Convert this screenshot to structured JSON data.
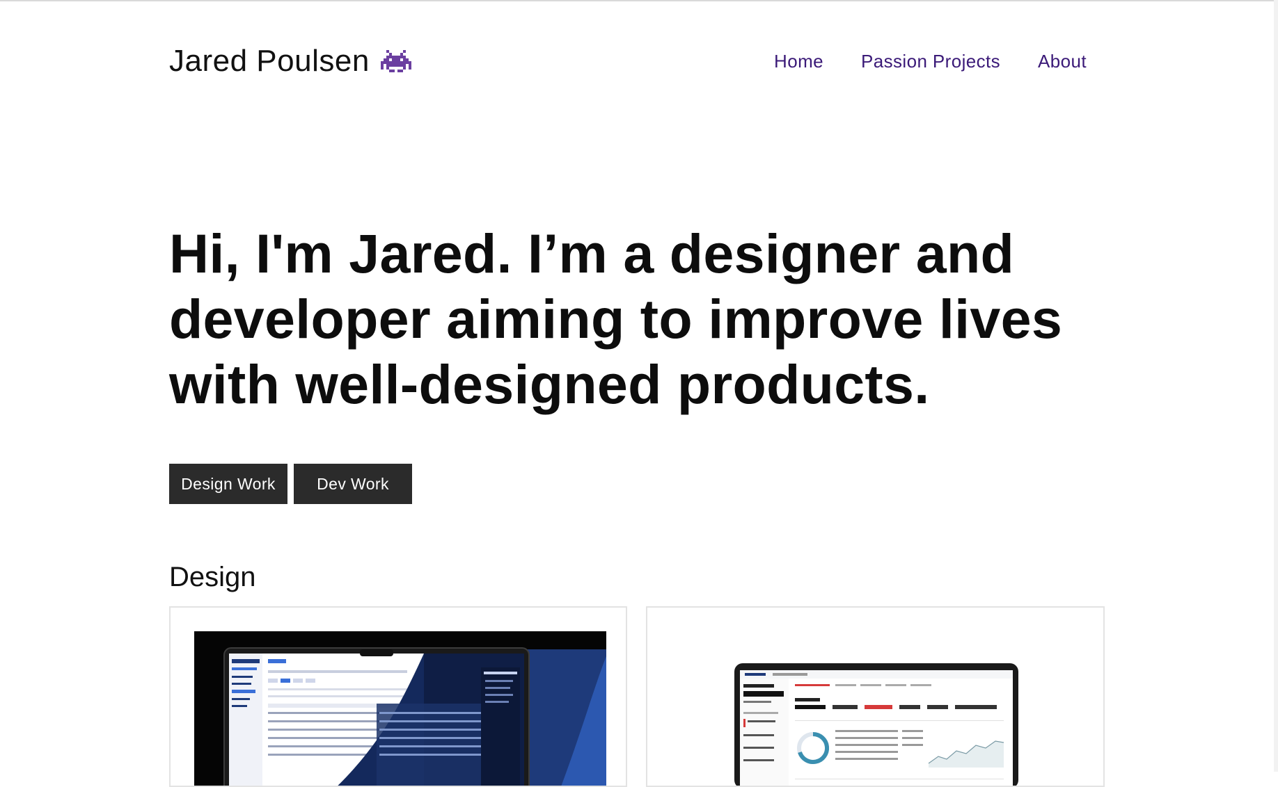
{
  "header": {
    "brand_name": "Jared Poulsen",
    "brand_icon": "alien-monster-icon",
    "nav": [
      {
        "label": "Home"
      },
      {
        "label": "Passion Projects"
      },
      {
        "label": "About"
      }
    ]
  },
  "hero": {
    "headline": "Hi, I'm Jared. I’m a designer and developer aiming to improve lives with well-designed products."
  },
  "cta": {
    "design_label": "Design Work",
    "dev_label": "Dev Work"
  },
  "sections": {
    "design_title": "Design"
  },
  "colors": {
    "nav_link": "#3b1a78",
    "button_bg": "#2b2b2b",
    "alien": "#6b3fa0"
  }
}
